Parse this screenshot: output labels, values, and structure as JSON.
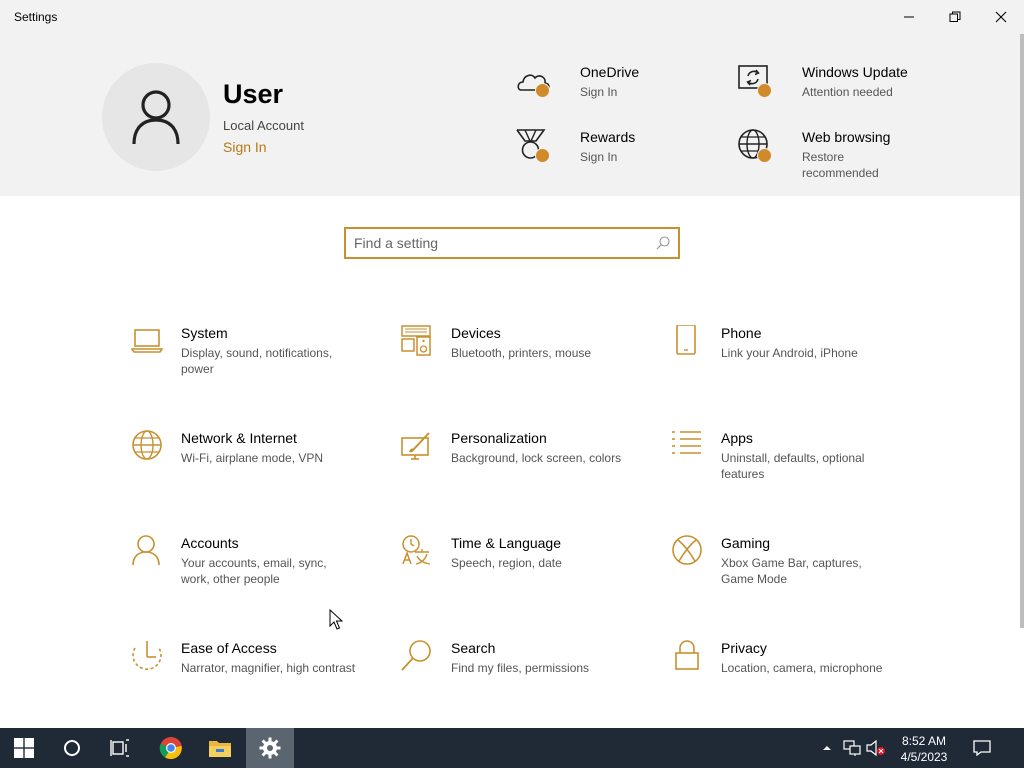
{
  "window": {
    "title": "Settings"
  },
  "user": {
    "name": "User",
    "account_type": "Local Account",
    "sign_in": "Sign In"
  },
  "quick_links": [
    {
      "title": "OneDrive",
      "subtitle": "Sign In",
      "icon": "cloud-icon"
    },
    {
      "title": "Windows Update",
      "subtitle": "Attention needed",
      "icon": "update-icon"
    },
    {
      "title": "Rewards",
      "subtitle": "Sign In",
      "icon": "medal-icon"
    },
    {
      "title": "Web browsing",
      "subtitle": "Restore recommended",
      "icon": "globe-icon"
    }
  ],
  "search": {
    "placeholder": "Find a setting"
  },
  "categories": [
    {
      "name": "System",
      "desc": "Display, sound, notifications, power",
      "icon": "laptop-icon"
    },
    {
      "name": "Devices",
      "desc": "Bluetooth, printers, mouse",
      "icon": "keyboard-speaker-icon"
    },
    {
      "name": "Phone",
      "desc": "Link your Android, iPhone",
      "icon": "phone-icon"
    },
    {
      "name": "Network & Internet",
      "desc": "Wi-Fi, airplane mode, VPN",
      "icon": "globe-icon"
    },
    {
      "name": "Personalization",
      "desc": "Background, lock screen, colors",
      "icon": "paint-icon"
    },
    {
      "name": "Apps",
      "desc": "Uninstall, defaults, optional features",
      "icon": "apps-list-icon"
    },
    {
      "name": "Accounts",
      "desc": "Your accounts, email, sync, work, other people",
      "icon": "person-icon"
    },
    {
      "name": "Time & Language",
      "desc": "Speech, region, date",
      "icon": "time-language-icon"
    },
    {
      "name": "Gaming",
      "desc": "Xbox Game Bar, captures, Game Mode",
      "icon": "xbox-icon"
    },
    {
      "name": "Ease of Access",
      "desc": "Narrator, magnifier, high contrast",
      "icon": "ease-of-access-icon"
    },
    {
      "name": "Search",
      "desc": "Find my files, permissions",
      "icon": "magnifier-icon"
    },
    {
      "name": "Privacy",
      "desc": "Location, camera, microphone",
      "icon": "lock-icon"
    }
  ],
  "taskbar": {
    "time": "8:52 AM",
    "date": "4/5/2023"
  },
  "colors": {
    "accent": "#c89130",
    "badge": "#d08a2a",
    "header_bg": "#f2f2f2",
    "taskbar_bg": "#1f2a36"
  }
}
